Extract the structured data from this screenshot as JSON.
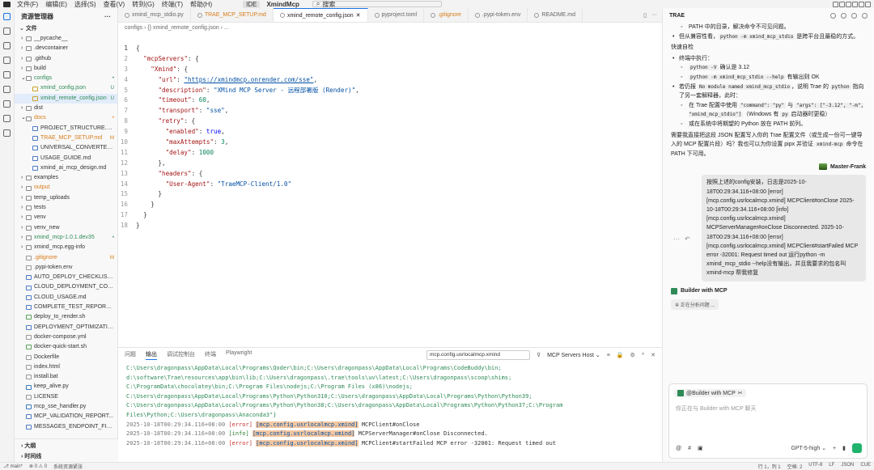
{
  "titlebar": {
    "menus": [
      "文件(F)",
      "编辑(E)",
      "选择(S)",
      "查看(V)",
      "转到(G)",
      "终端(T)",
      "帮助(H)"
    ],
    "ide_label": "IDE",
    "project": "XmindMcp",
    "search": "搜索"
  },
  "explorer": {
    "title": "资源管理器",
    "section": "文件",
    "items": [
      {
        "label": "__pycache__",
        "type": "folder",
        "indent": 1,
        "color": ""
      },
      {
        "label": ".devcontainer",
        "type": "folder",
        "indent": 1,
        "color": ""
      },
      {
        "label": ".github",
        "type": "folder",
        "indent": 1,
        "color": ""
      },
      {
        "label": "build",
        "type": "folder",
        "indent": 1,
        "color": ""
      },
      {
        "label": "configs",
        "type": "folder-open",
        "indent": 1,
        "color": "g",
        "badge": "•"
      },
      {
        "label": "xmind_config.json",
        "type": "json",
        "indent": 2,
        "color": "g",
        "badge": "U"
      },
      {
        "label": "xmind_remote_config.json",
        "type": "json",
        "indent": 2,
        "color": "g",
        "badge": "U",
        "selected": true
      },
      {
        "label": "dist",
        "type": "folder",
        "indent": 1,
        "color": ""
      },
      {
        "label": "docs",
        "type": "folder-open",
        "indent": 1,
        "color": "o",
        "badge": "•"
      },
      {
        "label": "PROJECT_STRUCTURE.md",
        "type": "md",
        "indent": 2,
        "color": ""
      },
      {
        "label": "TRAE_MCP_SETUP.md",
        "type": "md",
        "indent": 2,
        "color": "o",
        "badge": "M"
      },
      {
        "label": "UNIVERSAL_CONVERTER_...",
        "type": "md",
        "indent": 2,
        "color": ""
      },
      {
        "label": "USAGE_GUIDE.md",
        "type": "md",
        "indent": 2,
        "color": ""
      },
      {
        "label": "xmind_ai_mcp_design.md",
        "type": "md",
        "indent": 2,
        "color": ""
      },
      {
        "label": "examples",
        "type": "folder",
        "indent": 1,
        "color": ""
      },
      {
        "label": "output",
        "type": "folder",
        "indent": 1,
        "color": "o"
      },
      {
        "label": "temp_uploads",
        "type": "folder",
        "indent": 1,
        "color": ""
      },
      {
        "label": "tests",
        "type": "folder",
        "indent": 1,
        "color": ""
      },
      {
        "label": "venv",
        "type": "folder",
        "indent": 1,
        "color": ""
      },
      {
        "label": "venv_new",
        "type": "folder",
        "indent": 1,
        "color": ""
      },
      {
        "label": "xmind_mcp-1.0.1.dev35",
        "type": "folder",
        "indent": 1,
        "color": "g",
        "badge": "•"
      },
      {
        "label": "xmind_mcp.egg-info",
        "type": "folder",
        "indent": 1,
        "color": ""
      },
      {
        "label": ".gitignore",
        "type": "file",
        "indent": 1,
        "color": "o",
        "badge": "M"
      },
      {
        "label": ".pypi-token.env",
        "type": "file",
        "indent": 1,
        "color": ""
      },
      {
        "label": "AUTO_DEPLOY_CHECKLIST.md",
        "type": "md",
        "indent": 1,
        "color": ""
      },
      {
        "label": "CLOUD_DEPLOYMENT_COM...",
        "type": "md",
        "indent": 1,
        "color": ""
      },
      {
        "label": "CLOUD_USAGE.md",
        "type": "md",
        "indent": 1,
        "color": ""
      },
      {
        "label": "COMPLETE_TEST_REPORT.md",
        "type": "md",
        "indent": 1,
        "color": ""
      },
      {
        "label": "deploy_to_render.sh",
        "type": "sh",
        "indent": 1,
        "color": ""
      },
      {
        "label": "DEPLOYMENT_OPTIMIZATIO...",
        "type": "md",
        "indent": 1,
        "color": ""
      },
      {
        "label": "docker-compose.yml",
        "type": "file",
        "indent": 1,
        "color": ""
      },
      {
        "label": "docker-quick-start.sh",
        "type": "sh",
        "indent": 1,
        "color": ""
      },
      {
        "label": "Dockerfile",
        "type": "file",
        "indent": 1,
        "color": ""
      },
      {
        "label": "index.html",
        "type": "file",
        "indent": 1,
        "color": ""
      },
      {
        "label": "install.bat",
        "type": "file",
        "indent": 1,
        "color": ""
      },
      {
        "label": "keep_alive.py",
        "type": "py",
        "indent": 1,
        "color": ""
      },
      {
        "label": "LICENSE",
        "type": "file",
        "indent": 1,
        "color": ""
      },
      {
        "label": "mcp_sse_handler.py",
        "type": "py",
        "indent": 1,
        "color": ""
      },
      {
        "label": "MCP_VALIDATION_REPORT...",
        "type": "md",
        "indent": 1,
        "color": ""
      },
      {
        "label": "MESSAGES_ENDPOINT_FIX...",
        "type": "md",
        "indent": 1,
        "color": ""
      }
    ],
    "outline": "大纲",
    "timeline": "时间线"
  },
  "editor": {
    "tabs": [
      {
        "label": "xmind_mcp_stdio.py",
        "style": ""
      },
      {
        "label": "TRAE_MCP_SETUP.md",
        "style": "o"
      },
      {
        "label": "xmind_remote_config.json",
        "style": "active"
      },
      {
        "label": "pyproject.toml",
        "style": ""
      },
      {
        "label": ".gitignore",
        "style": "o"
      },
      {
        "label": ".pypi-token.env",
        "style": ""
      },
      {
        "label": "README.md",
        "style": ""
      }
    ],
    "breadcrumb": "configs  ›  {} xmind_remote_config.json  ›  ...",
    "code": [
      [
        [
          "p",
          "{"
        ]
      ],
      [
        [
          "p",
          "  "
        ],
        [
          "k",
          "\"mcpServers\""
        ],
        [
          "p",
          ": {"
        ]
      ],
      [
        [
          "p",
          "    "
        ],
        [
          "k",
          "\"Xmind\""
        ],
        [
          "p",
          ": {"
        ]
      ],
      [
        [
          "p",
          "      "
        ],
        [
          "k",
          "\"url\""
        ],
        [
          "p",
          ": "
        ],
        [
          "u",
          "\"https://xmindmcp.onrender.com/sse\""
        ],
        [
          "p",
          ","
        ]
      ],
      [
        [
          "p",
          "      "
        ],
        [
          "k",
          "\"description\""
        ],
        [
          "p",
          ": "
        ],
        [
          "s",
          "\"XMind MCP Server - 远程部署版 (Render)\""
        ],
        [
          "p",
          ","
        ]
      ],
      [
        [
          "p",
          "      "
        ],
        [
          "k",
          "\"timeout\""
        ],
        [
          "p",
          ": "
        ],
        [
          "n",
          "60"
        ],
        [
          "p",
          ","
        ]
      ],
      [
        [
          "p",
          "      "
        ],
        [
          "k",
          "\"transport\""
        ],
        [
          "p",
          ": "
        ],
        [
          "s",
          "\"sse\""
        ],
        [
          "p",
          ","
        ]
      ],
      [
        [
          "p",
          "      "
        ],
        [
          "k",
          "\"retry\""
        ],
        [
          "p",
          ": {"
        ]
      ],
      [
        [
          "p",
          "        "
        ],
        [
          "k",
          "\"enabled\""
        ],
        [
          "p",
          ": "
        ],
        [
          "b",
          "true"
        ],
        [
          "p",
          ","
        ]
      ],
      [
        [
          "p",
          "        "
        ],
        [
          "k",
          "\"maxAttempts\""
        ],
        [
          "p",
          ": "
        ],
        [
          "n",
          "3"
        ],
        [
          "p",
          ","
        ]
      ],
      [
        [
          "p",
          "        "
        ],
        [
          "k",
          "\"delay\""
        ],
        [
          "p",
          ": "
        ],
        [
          "n",
          "1000"
        ]
      ],
      [
        [
          "p",
          "      },"
        ]
      ],
      [
        [
          "p",
          "      "
        ],
        [
          "k",
          "\"headers\""
        ],
        [
          "p",
          ": {"
        ]
      ],
      [
        [
          "p",
          "        "
        ],
        [
          "k",
          "\"User-Agent\""
        ],
        [
          "p",
          ": "
        ],
        [
          "s",
          "\"TraeMCP-Client/1.0\""
        ]
      ],
      [
        [
          "p",
          "      }"
        ]
      ],
      [
        [
          "p",
          "    }"
        ]
      ],
      [
        [
          "p",
          "  }"
        ]
      ],
      [
        [
          "p",
          "}"
        ]
      ]
    ]
  },
  "panel": {
    "tabs": [
      "问题",
      "输出",
      "调试控制台",
      "终端",
      "Playwright"
    ],
    "active_tab": "输出",
    "filter_value": "mcp.config.usrlocalmcp.xmind",
    "source": "MCP Servers Host",
    "path_lines": [
      "C:\\Users\\dragonpass\\AppData\\Local\\Programs\\Qoder\\bin;C:\\Users\\dragonpass\\AppData\\Local\\Programs\\CodeBuddy\\bin;",
      "d:\\software\\Trae\\resources\\app\\bin\\lib;C:\\Users\\dragonpass\\.trae\\tools\\uv\\latest;C:\\Users\\dragonpass\\scoop\\shims;",
      "C:\\ProgramData\\chocolatey\\bin;C:\\Program Files\\nodejs;C:\\Program Files (x86)\\nodejs;",
      "C:\\Users\\dragonpass\\AppData\\Local\\Programs\\Python\\Python310;C:\\Users\\dragonpass\\AppData\\Local\\Programs\\Python\\Python39;",
      "C:\\Users\\dragonpass\\AppData\\Local\\Programs\\Python\\Python38;C:\\Users\\dragonpass\\AppData\\Local\\Programs\\Python\\Python37;C:\\Program",
      "Files\\Python;C:\\Users\\dragonpass\\Anaconda3\"}"
    ],
    "log_lines": [
      {
        "ts": "2025-10-18T00:29:34.116+08:00",
        "level": "[error]",
        "tag": "[mcp.config.usrlocalmcp.xmind]",
        "msg": "MCPClient#onClose"
      },
      {
        "ts": "2025-10-18T00:29:34.116+08:00",
        "level": "[info]",
        "tag": "[mcp.config.usrlocalmcp.xmind]",
        "msg": "MCPServerManager#onClose Disconnected."
      },
      {
        "ts": "2025-10-18T00:29:34.116+08:00",
        "level": "[error]",
        "tag": "[mcp.config.usrlocalmcp.xmind]",
        "msg": "MCPClient#startFailed MCP error -32001: Request timed out"
      }
    ]
  },
  "chat": {
    "title": "TRAE",
    "assistant_lines": [
      {
        "kind": "sub",
        "html": "PATH 中的目录，解决命令不可见问题。"
      },
      {
        "kind": "bul",
        "html": "但从兼容性看，<code>python -m xmind_mcp_stdio</code> 是跨平台且最稳的方式。"
      },
      {
        "kind": "p",
        "html": "快速自检"
      },
      {
        "kind": "bul",
        "html": "终端中执行："
      },
      {
        "kind": "sub",
        "html": "<code>python -V</code> 确认是 3.12"
      },
      {
        "kind": "sub",
        "html": "<code>python -m xmind_mcp_stdio --help</code> 有输出则 OK"
      },
      {
        "kind": "bul",
        "html": "若仍报 <code>No module named xmind_mcp_stdio</code>，说明 Trae 的 <code>python</code> 指向了另一套解释器，此时："
      },
      {
        "kind": "sub",
        "html": "在 Trae 配置中使用 <code>\"command\": \"py\"</code> 与 <code>\"args\": [\"-3.12\", \"-m\", \"xmind_mcp_stdio\"]</code>（Windows 有 <code>py</code> 启动器时更稳）"
      },
      {
        "kind": "sub",
        "html": "或在系统中将期望的 Python 放在 PATH 前列。"
      },
      {
        "kind": "p",
        "html": "需要我直接把这段 JSON 配置写入你的 Trae 配置文件（或生成一份可一键导入的 MCP 配置片段）吗？我也可以为你设置 pipx 并验证 <code>xmind-mcp</code> 命令在 PATH 下可用。"
      }
    ],
    "user_name": "Master-Frank",
    "user_message": "按照上述的config安装，日志是2025-10-18T00:29:34.116+08:00 [error] [mcp.config.usrlocalmcp.xmind] MCPClient#onClose 2025-10-18T00:29:34.116+08:00 [info] [mcp.config.usrlocalmcp.xmind] MCPServerManager#onClose Disconnected. 2025-10-18T00:29:34.116+08:00 [error] [mcp.config.usrlocalmcp.xmind] MCPClient#startFailed MCP error -32001: Request timed out 运行python -m xmind_mcp_stdio --help没有输出，并且我要求的包名叫xmind-mcp 帮我修复",
    "builder_name": "Builder with MCP",
    "thinking": "正在分析问题 ...",
    "input_chip": "@Builder with MCP",
    "input_placeholder": "你正在与 Builder with MCP 聊天",
    "model": "GPT-5-high"
  },
  "statusbar": {
    "branch": "main*",
    "errors": "0",
    "warnings": "0",
    "message": "系统资源紧张",
    "position": "行 1，列 1",
    "spaces": "空格: 2",
    "encoding": "UTF-8",
    "eol": "LF",
    "lang": "JSON",
    "ime": "CUE"
  }
}
